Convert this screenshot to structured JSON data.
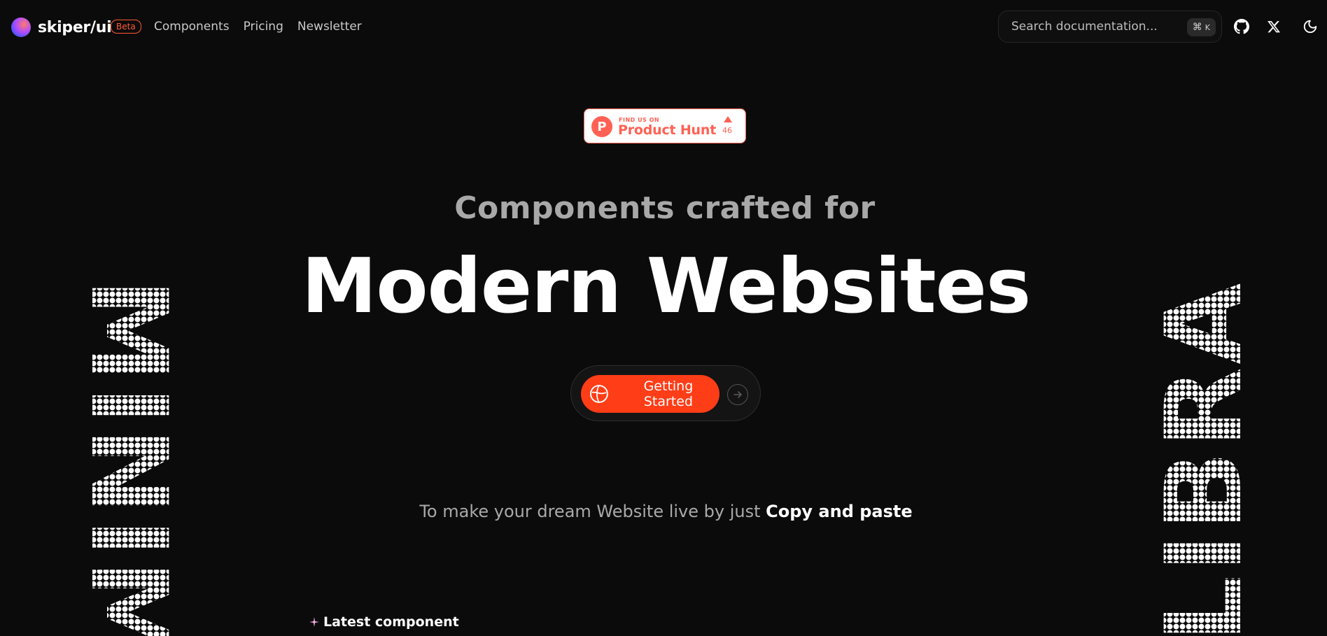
{
  "header": {
    "brand": "skiper/ui",
    "beta": "Beta",
    "nav": [
      "Components",
      "Pricing",
      "Newsletter"
    ],
    "search_placeholder": "Search documentation...",
    "shortcut_symbol": "⌘",
    "shortcut_key": "K",
    "icons": [
      "github-icon",
      "x-icon",
      "moon-icon"
    ]
  },
  "badge": {
    "find": "FIND US ON",
    "name": "Product Hunt",
    "logo_letter": "P",
    "count": "46"
  },
  "hero": {
    "subhead": "Components crafted for",
    "headline": "Modern Websites",
    "cta": "Getting Started",
    "tagline_prefix": "To make your dream Website live by just ",
    "tagline_emphasis": "Copy and paste"
  },
  "side": {
    "left_word": "MINIMALISM",
    "right_word": "LIBRARY"
  },
  "latest": {
    "label": "Latest component"
  },
  "colors": {
    "background": "#0b0b0b",
    "accent": "#ff3d17",
    "product_hunt": "#ff6154"
  }
}
